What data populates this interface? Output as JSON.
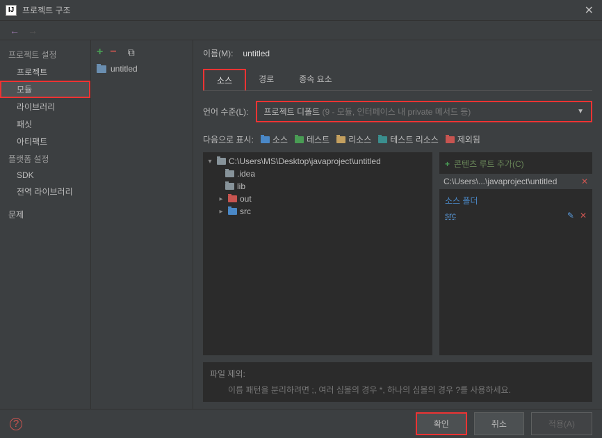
{
  "title": "프로젝트 구조",
  "sidebar": {
    "section1": "프로젝트 설정",
    "items1": [
      "프로젝트",
      "모듈",
      "라이브러리",
      "패싯",
      "아티팩트"
    ],
    "section2": "플랫폼 설정",
    "items2": [
      "SDK",
      "전역 라이브러리"
    ],
    "problem": "문제"
  },
  "module": {
    "name": "untitled"
  },
  "content": {
    "name_label": "이름(M):",
    "name_value": "untitled",
    "tabs": [
      "소스",
      "경로",
      "종속 요소"
    ],
    "lang_label": "언어 수준(L):",
    "lang_value": "프로젝트 디폴트",
    "lang_detail": " (9 - 모듈, 인터페이스 내 private 메서드 등)",
    "display_label": "다음으로 표시:",
    "chips": [
      "소스",
      "테스트",
      "리소스",
      "테스트 리소스",
      "제외됨"
    ],
    "tree_root": "C:\\Users\\MS\\Desktop\\javaproject\\untitled",
    "tree_items": [
      ".idea",
      "lib",
      "out",
      "src"
    ],
    "add_root": "콘텐츠 루트 추가(C)",
    "root_path": "C:\\Users\\...\\javaproject\\untitled",
    "src_heading": "소스 폴더",
    "src_item": "src",
    "exclude_label": "파일 제외:",
    "exclude_help": "이름 패턴을 분리하려면 ;, 여러 심볼의 경우 *, 하나의 심볼의 경우 ?를 사용하세요."
  },
  "footer": {
    "ok": "확인",
    "cancel": "취소",
    "apply": "적용(A)"
  }
}
